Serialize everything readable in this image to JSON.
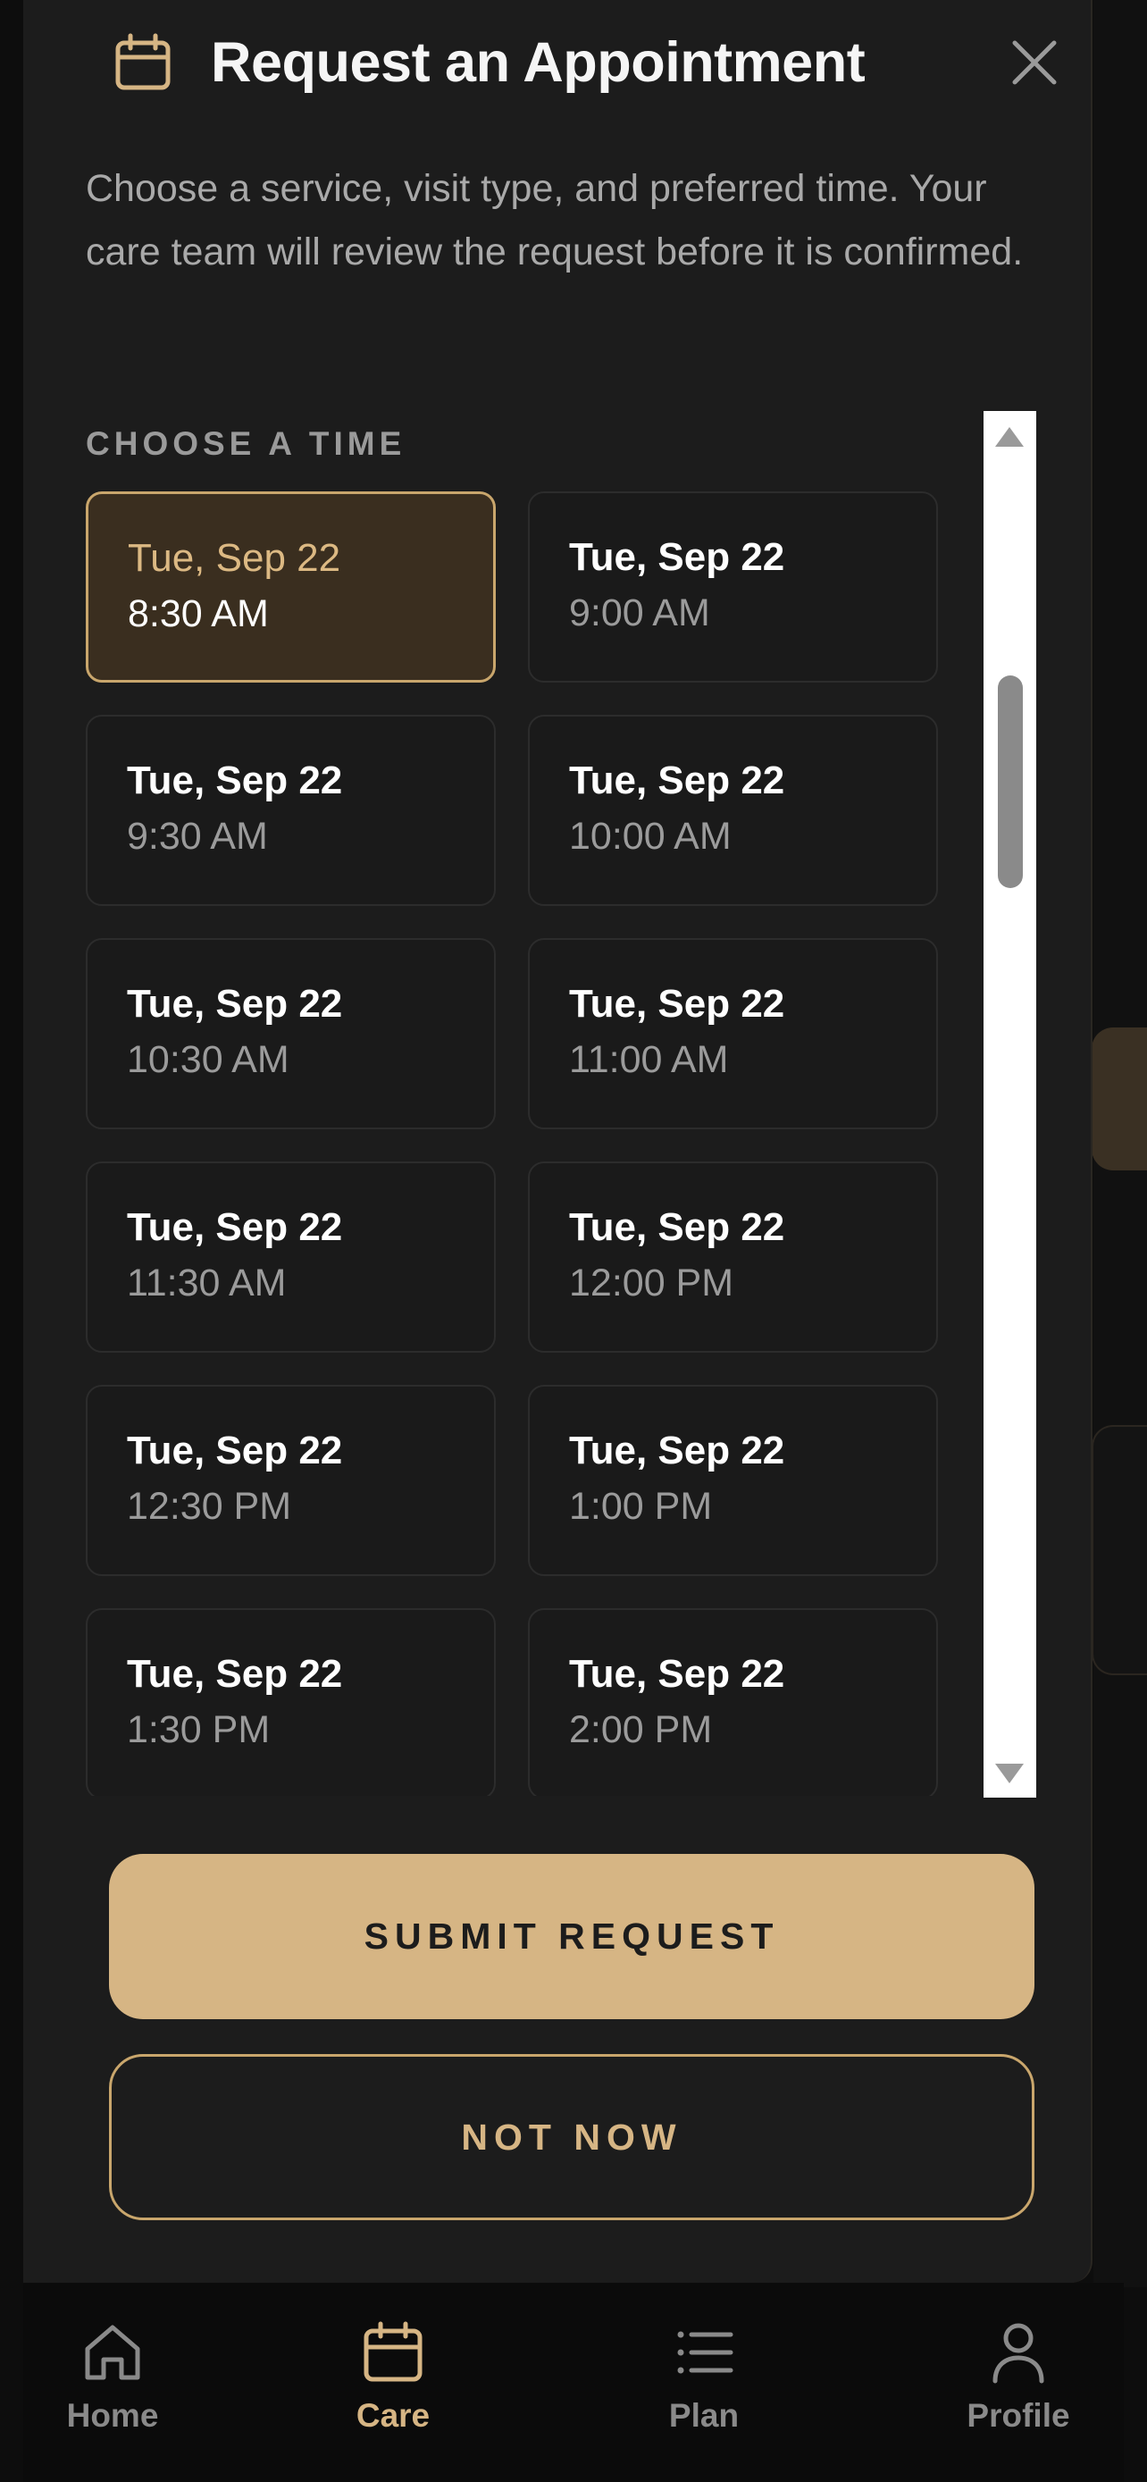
{
  "modal": {
    "title": "Request an Appointment",
    "description": "Choose a service, visit type, and preferred time. Your care team will review the request before it is confirmed.",
    "section_label": "CHOOSE A TIME",
    "slots": [
      {
        "date": "Tue, Sep 22",
        "time": "8:30 AM",
        "selected": true
      },
      {
        "date": "Tue, Sep 22",
        "time": "9:00 AM",
        "selected": false
      },
      {
        "date": "Tue, Sep 22",
        "time": "9:30 AM",
        "selected": false
      },
      {
        "date": "Tue, Sep 22",
        "time": "10:00 AM",
        "selected": false
      },
      {
        "date": "Tue, Sep 22",
        "time": "10:30 AM",
        "selected": false
      },
      {
        "date": "Tue, Sep 22",
        "time": "11:00 AM",
        "selected": false
      },
      {
        "date": "Tue, Sep 22",
        "time": "11:30 AM",
        "selected": false
      },
      {
        "date": "Tue, Sep 22",
        "time": "12:00 PM",
        "selected": false
      },
      {
        "date": "Tue, Sep 22",
        "time": "12:30 PM",
        "selected": false
      },
      {
        "date": "Tue, Sep 22",
        "time": "1:00 PM",
        "selected": false
      },
      {
        "date": "Tue, Sep 22",
        "time": "1:30 PM",
        "selected": false
      },
      {
        "date": "Tue, Sep 22",
        "time": "2:00 PM",
        "selected": false
      }
    ],
    "submit_label": "SUBMIT REQUEST",
    "cancel_label": "NOT NOW"
  },
  "tabbar": {
    "tabs": [
      {
        "label": "Home",
        "icon": "home-icon",
        "active": false
      },
      {
        "label": "Care",
        "icon": "calendar-icon",
        "active": true
      },
      {
        "label": "Plan",
        "icon": "list-icon",
        "active": false
      },
      {
        "label": "Profile",
        "icon": "person-icon",
        "active": false
      }
    ]
  },
  "colors": {
    "accent": "#d6b584",
    "accent_border": "#c9a66c",
    "sheet_bg": "#1c1c1c",
    "selected_bg": "#3a2e1f",
    "muted_text": "#9b9b9b"
  }
}
